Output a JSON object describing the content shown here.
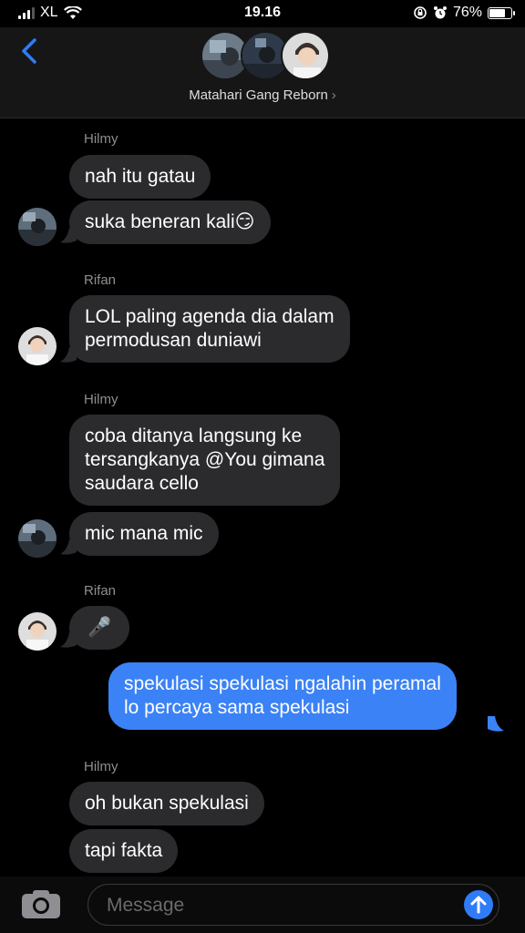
{
  "status_bar": {
    "carrier": "XL",
    "time": "19.16",
    "battery": "76%",
    "battery_level": 0.76
  },
  "header": {
    "group_name": "Matahari Gang Reborn"
  },
  "messages": [
    {
      "sender": "Hilmy"
    },
    {
      "text": "nah itu gatau"
    },
    {
      "text": "suka beneran kali😏"
    },
    {
      "sender": "Rifan"
    },
    {
      "line1": "LOL paling agenda dia dalam",
      "line2": "permodusan duniawi"
    },
    {
      "sender": "Hilmy"
    },
    {
      "line1": "coba ditanya langsung ke",
      "line2": "tersangkanya @You gimana",
      "line3": "saudara cello"
    },
    {
      "text": "mic mana mic"
    },
    {
      "sender": "Rifan"
    },
    {
      "text": "🎤"
    },
    {
      "line1": "spekulasi spekulasi ngalahin peramal",
      "line2": "lo percaya sama spekulasi"
    },
    {
      "sender": "Hilmy"
    },
    {
      "text": "oh bukan spekulasi"
    },
    {
      "text": "tapi fakta"
    }
  ],
  "composer": {
    "placeholder": "Message"
  },
  "colors": {
    "incoming_bubble": "#2b2b2e",
    "outgoing_bubble": "#3b82f6",
    "accent": "#2f7cf6"
  }
}
